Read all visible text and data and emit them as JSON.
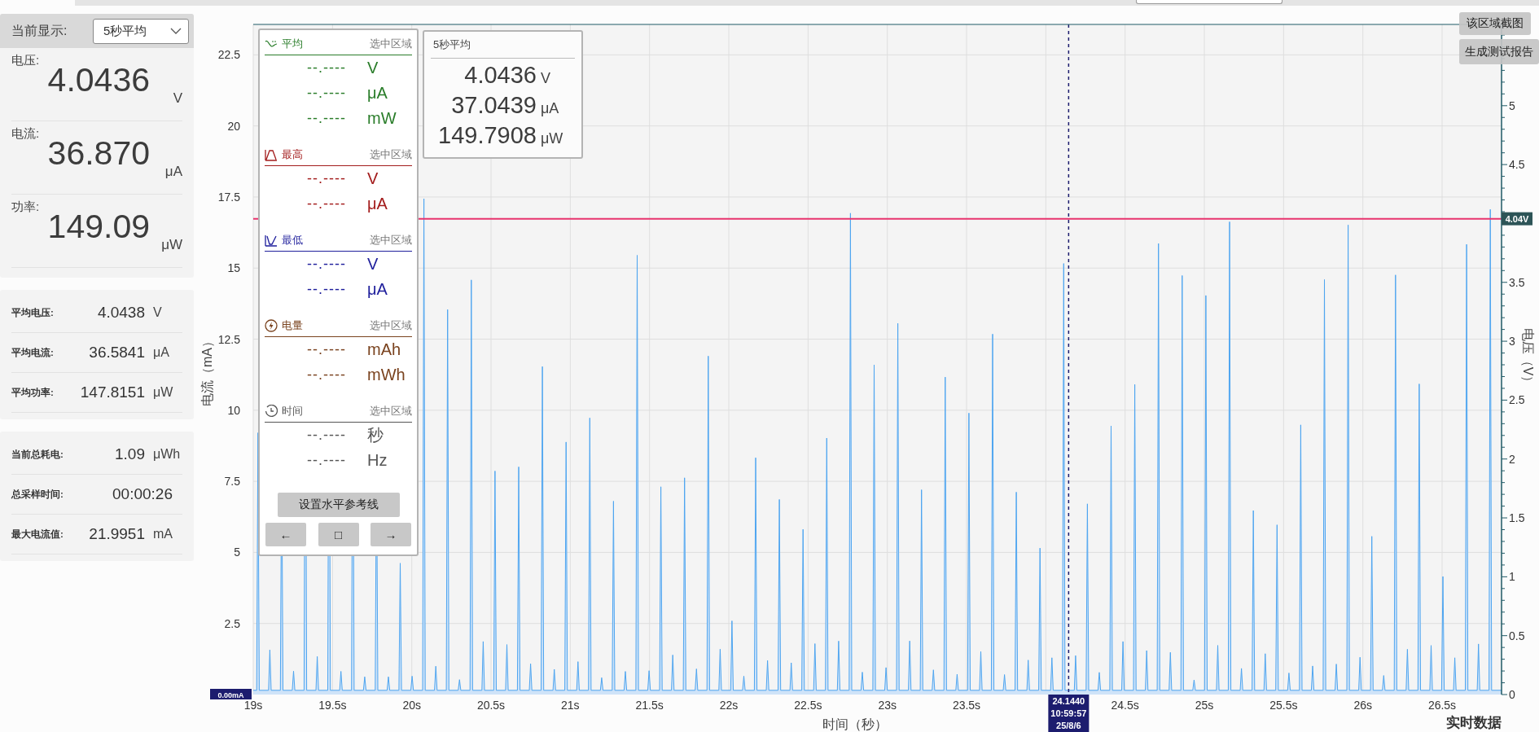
{
  "display_selector": {
    "label": "当前显示:",
    "value": "5秒平均"
  },
  "live_readings": [
    {
      "label": "电压:",
      "value": "4.0436",
      "unit": "V"
    },
    {
      "label": "电流:",
      "value": "36.870",
      "unit": "μA"
    },
    {
      "label": "功率:",
      "value": "149.09",
      "unit": "μW"
    }
  ],
  "averages": [
    {
      "label": "平均电压:",
      "value": "4.0438",
      "unit": "V"
    },
    {
      "label": "平均电流:",
      "value": "36.5841",
      "unit": "μA"
    },
    {
      "label": "平均功率:",
      "value": "147.8151",
      "unit": "μW"
    }
  ],
  "totals": [
    {
      "label": "当前总耗电:",
      "value": "1.09",
      "unit": "μWh"
    },
    {
      "label": "总采样时间:",
      "value": "00:00:26"
    },
    {
      "label": "最大电流值:",
      "value": "21.9951",
      "unit": "mA"
    }
  ],
  "legend": {
    "sections": [
      {
        "kind": "average",
        "title": "平均",
        "scope": "选中区域",
        "color": "#2a7d2a",
        "rows": [
          {
            "value": "--.----",
            "unit": "V"
          },
          {
            "value": "--.----",
            "unit": "μA"
          },
          {
            "value": "--.----",
            "unit": "mW"
          }
        ]
      },
      {
        "kind": "max",
        "title": "最高",
        "scope": "选中区域",
        "color": "#a31c1c",
        "rows": [
          {
            "value": "--.----",
            "unit": "V"
          },
          {
            "value": "--.----",
            "unit": "μA"
          }
        ]
      },
      {
        "kind": "min",
        "title": "最低",
        "scope": "选中区域",
        "color": "#1f1f9c",
        "rows": [
          {
            "value": "--.----",
            "unit": "V"
          },
          {
            "value": "--.----",
            "unit": "μA"
          }
        ]
      },
      {
        "kind": "energy",
        "title": "电量",
        "scope": "选中区域",
        "color": "#7a431f",
        "rows": [
          {
            "value": "--.----",
            "unit": "mAh"
          },
          {
            "value": "--.----",
            "unit": "mWh"
          }
        ]
      },
      {
        "kind": "time",
        "title": "时间",
        "scope": "选中区域",
        "color": "#555555",
        "rows": [
          {
            "value": "--.----",
            "unit": "秒"
          },
          {
            "value": "--.----",
            "unit": "Hz"
          }
        ]
      }
    ],
    "reference_button": "设置水平参考线",
    "nav_buttons": [
      "←",
      "□",
      "→"
    ]
  },
  "readout": {
    "title": "5秒平均",
    "rows": [
      {
        "value": "4.0436",
        "unit": "V"
      },
      {
        "value": "37.0439",
        "unit": "μA"
      },
      {
        "value": "149.7908",
        "unit": "μW"
      }
    ]
  },
  "chart": {
    "chart_data": {
      "type": "line",
      "xlabel": "时间（秒）",
      "ylabel": "电流（mA）",
      "y2label": "电压（V）",
      "xlim": [
        19,
        26.875
      ],
      "ylim": [
        0,
        23.57
      ],
      "y2lim": [
        0,
        5.69
      ],
      "xticks": [
        {
          "value": 19,
          "label": "19s"
        },
        {
          "value": 19.5,
          "label": "19.5s"
        },
        {
          "value": 20,
          "label": "20s"
        },
        {
          "value": 20.5,
          "label": "20.5s"
        },
        {
          "value": 21,
          "label": "21s"
        },
        {
          "value": 21.5,
          "label": "21.5s"
        },
        {
          "value": 22,
          "label": "22s"
        },
        {
          "value": 22.5,
          "label": "22.5s"
        },
        {
          "value": 23,
          "label": "23s"
        },
        {
          "value": 23.5,
          "label": "23.5s"
        },
        {
          "value": 24.5,
          "label": "24.5s"
        },
        {
          "value": 25,
          "label": "25s"
        },
        {
          "value": 25.5,
          "label": "25.5s"
        },
        {
          "value": 26,
          "label": "26s"
        },
        {
          "value": 26.5,
          "label": "26.5s"
        }
      ],
      "yticks": [
        2.5,
        5,
        7.5,
        10,
        12.5,
        15,
        17.5,
        20,
        22.5
      ],
      "y2ticks": [
        0,
        0.5,
        1,
        1.5,
        2,
        2.5,
        3,
        3.5,
        4.5,
        5
      ],
      "x": [
        19,
        26.875
      ],
      "series": [
        {
          "color": "#e8336e",
          "axis": "y2",
          "values": [
            4.04,
            4.04
          ]
        }
      ],
      "grid": true,
      "annotations": [
        "0.00mA",
        "4.04V"
      ]
    },
    "cursor": {
      "text": [
        "24.1440",
        "10:59:57",
        "25/8/6"
      ]
    }
  },
  "buttons": [
    "该区域截图",
    "生成测试报告"
  ],
  "mode_label": "实时数据"
}
